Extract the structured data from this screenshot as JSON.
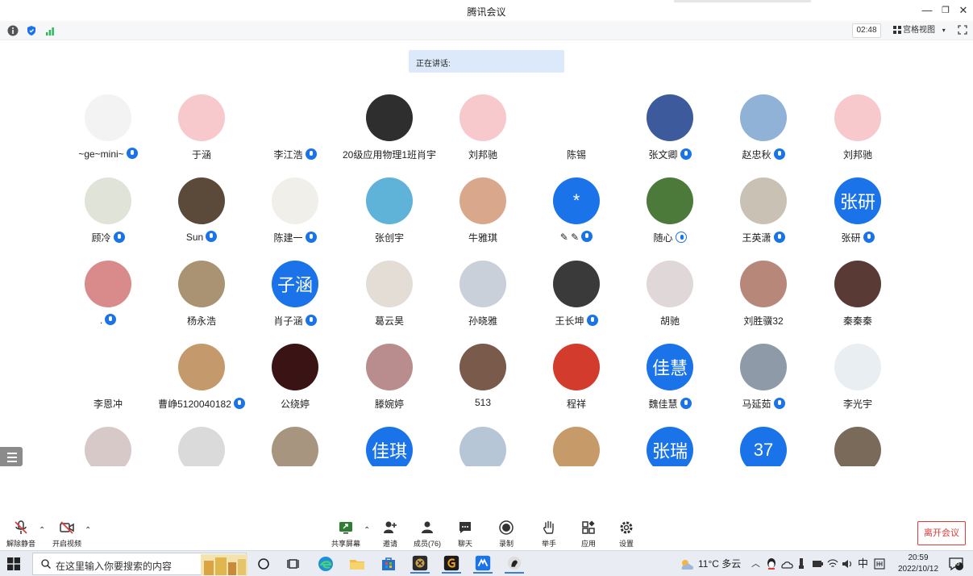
{
  "window": {
    "title": "腾讯会议",
    "minimize_glyph": "—",
    "restore_glyph": "❐",
    "close_glyph": "✕"
  },
  "toolbar": {
    "timer": "02:48",
    "view_label": "宫格视图",
    "view_caret": "▾",
    "icons": [
      "info-icon",
      "shield-icon",
      "signal-icon",
      "fullscreen-icon"
    ]
  },
  "speaking": {
    "label": "正在讲话:"
  },
  "participants": [
    {
      "name": "~ge~mini~",
      "mic": "on"
    },
    {
      "name": "于涵",
      "mic": "none"
    },
    {
      "name": "李江浩",
      "mic": "on"
    },
    {
      "name": "20级应用物理1班肖宇",
      "mic": "none"
    },
    {
      "name": "刘邦驰",
      "mic": "none"
    },
    {
      "name": "陈锡",
      "mic": "none"
    },
    {
      "name": "张文卿",
      "mic": "on"
    },
    {
      "name": "赵忠秋",
      "mic": "on"
    },
    {
      "name": "刘邦驰",
      "mic": "none"
    },
    {
      "name": "顾冷",
      "mic": "on"
    },
    {
      "name": "Sun",
      "mic": "on"
    },
    {
      "name": "陈建一",
      "mic": "on"
    },
    {
      "name": "张创宇",
      "mic": "none"
    },
    {
      "name": "牛雅琪",
      "mic": "none"
    },
    {
      "name": "✎ ✎",
      "mic": "on",
      "avatar_text": "*"
    },
    {
      "name": "随心",
      "mic": "hollow"
    },
    {
      "name": "王英潇",
      "mic": "on"
    },
    {
      "name": "张研",
      "mic": "on",
      "avatar_text": "张研"
    },
    {
      "name": ".",
      "mic": "on"
    },
    {
      "name": "杨永浩",
      "mic": "none"
    },
    {
      "name": "肖子涵",
      "mic": "on",
      "avatar_text": "子涵"
    },
    {
      "name": "葛云昊",
      "mic": "none"
    },
    {
      "name": "孙晓雅",
      "mic": "none"
    },
    {
      "name": "王长坤",
      "mic": "on"
    },
    {
      "name": "胡驰",
      "mic": "none"
    },
    {
      "name": "刘胜骥32",
      "mic": "none"
    },
    {
      "name": "秦秦秦",
      "mic": "none"
    },
    {
      "name": "李恩冲",
      "mic": "none"
    },
    {
      "name": "曹峥5120040182",
      "mic": "on"
    },
    {
      "name": "公绕婷",
      "mic": "none"
    },
    {
      "name": "滕婉婷",
      "mic": "none"
    },
    {
      "name": "513",
      "mic": "none"
    },
    {
      "name": "程祥",
      "mic": "none"
    },
    {
      "name": "魏佳慧",
      "mic": "on",
      "avatar_text": "佳慧"
    },
    {
      "name": "马延茹",
      "mic": "on"
    },
    {
      "name": "李光宇",
      "mic": "none"
    },
    {
      "name": "",
      "mic": "none"
    },
    {
      "name": "",
      "mic": "none"
    },
    {
      "name": "",
      "mic": "none"
    },
    {
      "name": "",
      "mic": "none",
      "avatar_text": "佳琪"
    },
    {
      "name": "",
      "mic": "none"
    },
    {
      "name": "",
      "mic": "none"
    },
    {
      "name": "",
      "mic": "none",
      "avatar_text": "张瑞"
    },
    {
      "name": "",
      "mic": "none",
      "avatar_text": "37"
    },
    {
      "name": "",
      "mic": "none"
    }
  ],
  "avatar_colors": [
    "#f3f3f3",
    "#f7c9cc",
    "#ffffff",
    "#2e2e2e",
    "#f7c9cc",
    "#ffffff",
    "#3d5a9c",
    "#8fb2d6",
    "#f7c9cc",
    "#dfe3d8",
    "#5b4a3a",
    "#f1efe9",
    "#5fb3d8",
    "#d9a88c",
    "#1a73e8",
    "#4b7a3a",
    "#c9c1b4",
    "#1a73e8",
    "#d98a8a",
    "#a99373",
    "#1a73e8",
    "#e4ddd5",
    "#c9d0d9",
    "#3a3a3a",
    "#e0d8d8",
    "#b7877a",
    "#5a3a34",
    "#ffffff",
    "#c49a6c",
    "#3a1414",
    "#b98d8d",
    "#7a5a4a",
    "#d33b2c",
    "#1a73e8",
    "#8e9aa8",
    "#e9eef2",
    "#d8c9c9",
    "#dadada",
    "#a89580",
    "#1a73e8",
    "#b7c6d6",
    "#c79a6a",
    "#1a73e8",
    "#1a73e8",
    "#7a6a5a"
  ],
  "meeting_bar": {
    "unmute": "解除静音",
    "start_video": "开启视频",
    "share_screen": "共享屏幕",
    "invite": "邀请",
    "members": "成员(76)",
    "chat": "聊天",
    "record": "录制",
    "raise_hand": "举手",
    "apps": "应用",
    "settings": "设置",
    "leave": "离开会议",
    "caret": "⌃"
  },
  "taskbar": {
    "search_placeholder": "在这里输入你要搜索的内容",
    "weather": "11°C 多云",
    "ime": "中",
    "time": "20:59",
    "date": "2022/10/12",
    "notification_count": "6"
  }
}
